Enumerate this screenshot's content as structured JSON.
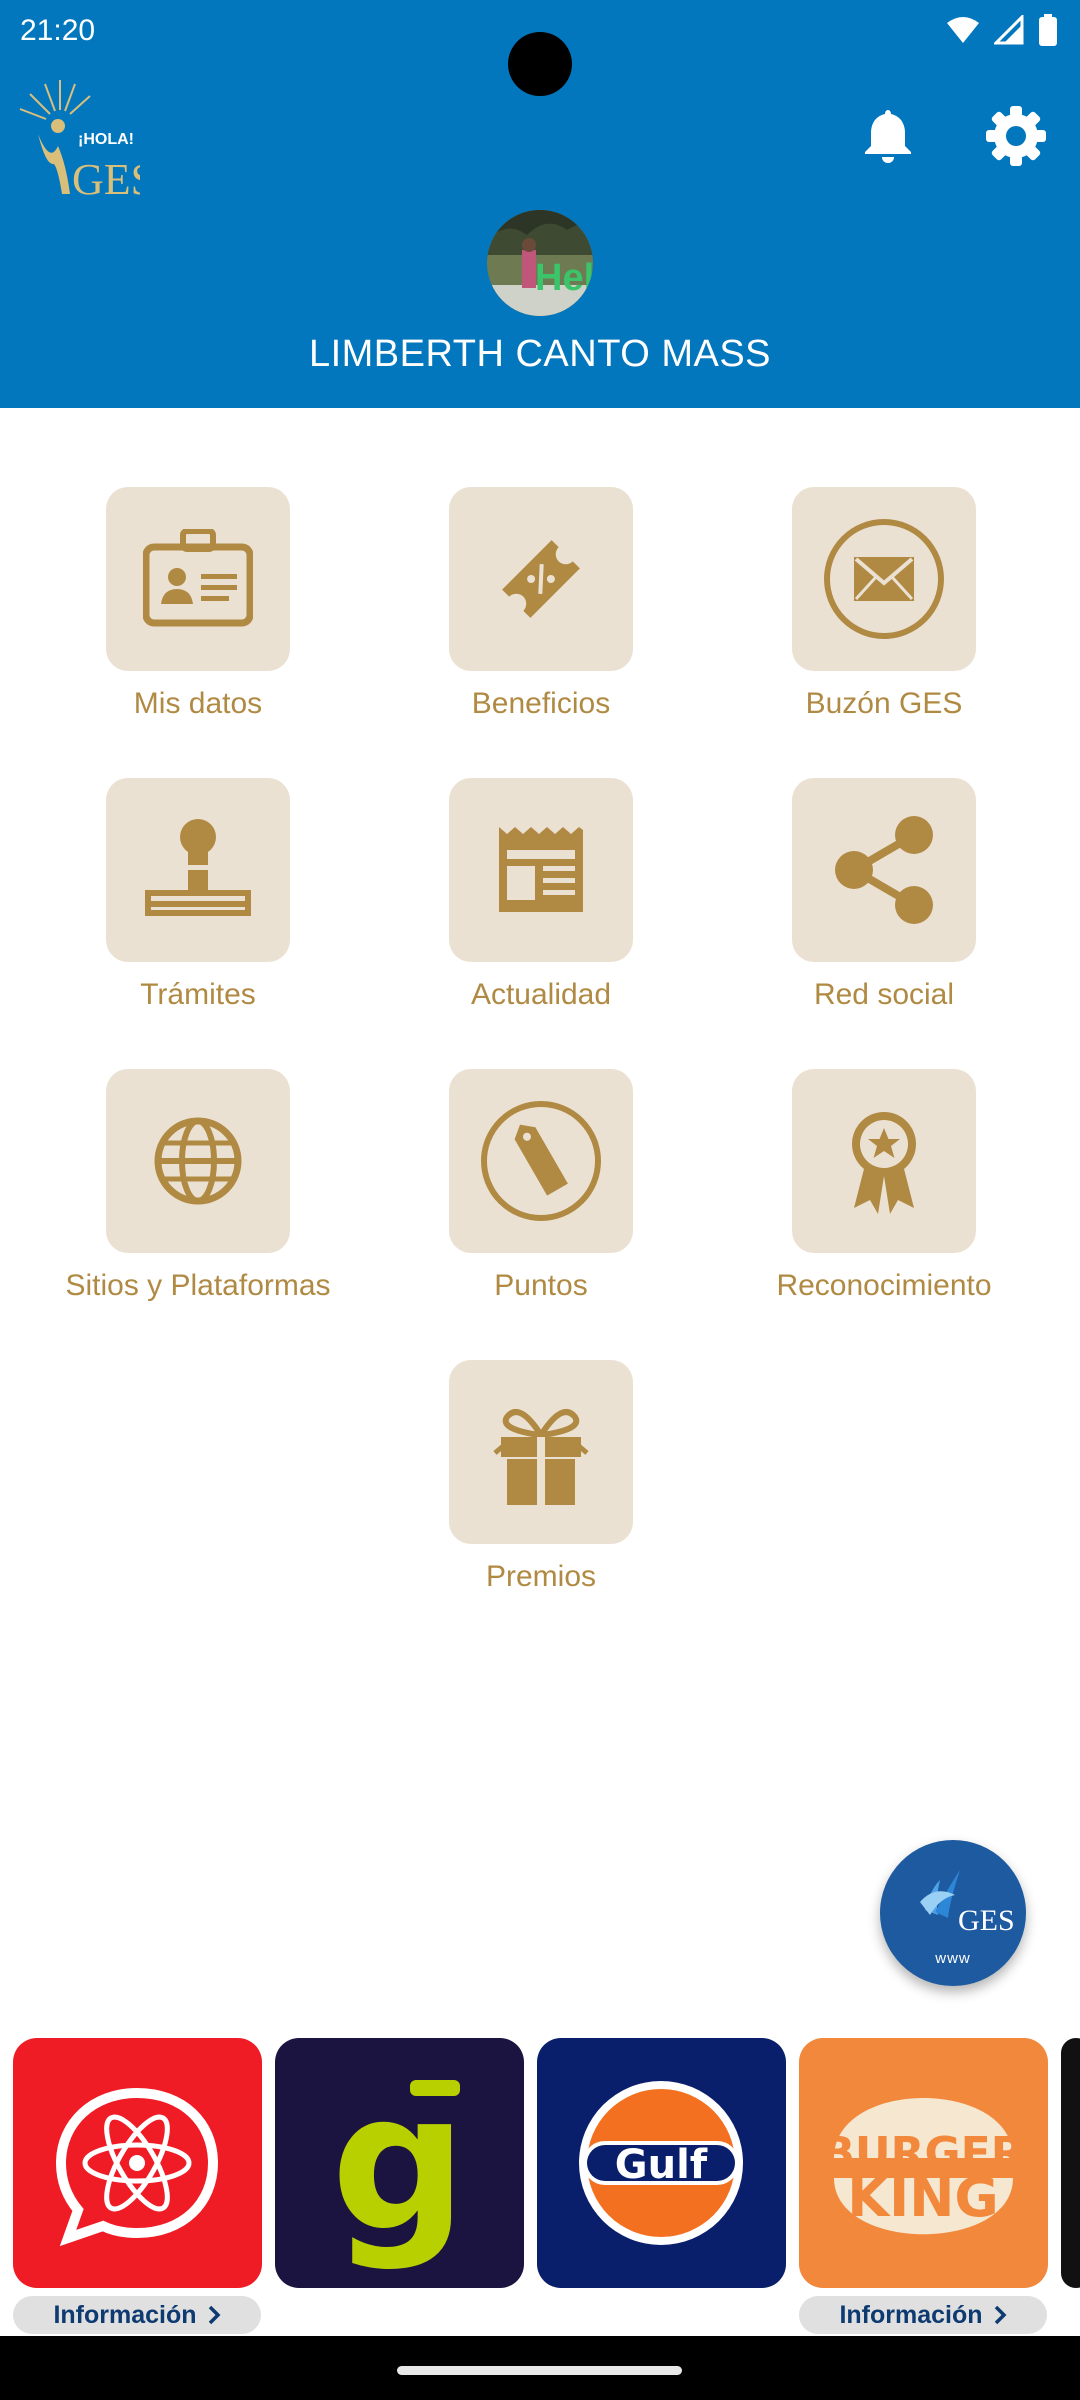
{
  "status_bar": {
    "time": "21:20"
  },
  "header": {
    "logo_text_hola": "¡HOLA!",
    "logo_text_ges": "GES",
    "user_name": "LIMBERTH CANTO MASS",
    "notifications_icon": "bell-icon",
    "settings_icon": "gear-icon",
    "avatar_text": "Hel"
  },
  "menu": {
    "items": [
      {
        "label": "Mis datos",
        "icon": "id-card-icon"
      },
      {
        "label": "Beneficios",
        "icon": "discount-tag-icon"
      },
      {
        "label": "Buzón GES",
        "icon": "envelope-icon"
      },
      {
        "label": "Trámites",
        "icon": "stamp-icon"
      },
      {
        "label": "Actualidad",
        "icon": "newspaper-icon"
      },
      {
        "label": "Red social",
        "icon": "share-icon"
      },
      {
        "label": "Sitios y Plataformas",
        "icon": "globe-icon"
      },
      {
        "label": "Puntos",
        "icon": "price-tag-icon"
      },
      {
        "label": "Reconocimiento",
        "icon": "award-ribbon-icon"
      },
      {
        "label": "Premios",
        "icon": "gift-icon"
      }
    ]
  },
  "fab": {
    "logo_text": "GES",
    "label": "www"
  },
  "brands": {
    "items": [
      {
        "name": "chat-atom",
        "bg": "#ef1c25"
      },
      {
        "name": "g",
        "bg": "#1b1440",
        "text": "g"
      },
      {
        "name": "Gulf",
        "bg": "#0a1f6b",
        "text": "Gulf"
      },
      {
        "name": "Burger King",
        "bg": "#f2883b",
        "text_top": "BURGER",
        "text_bottom": "KING"
      }
    ],
    "info_label": "Información"
  },
  "colors": {
    "header_bg": "#0277bd",
    "tile_bg": "#ebe1d3",
    "tile_icon": "#b08a43",
    "fab_bg": "#1d5aa0"
  }
}
